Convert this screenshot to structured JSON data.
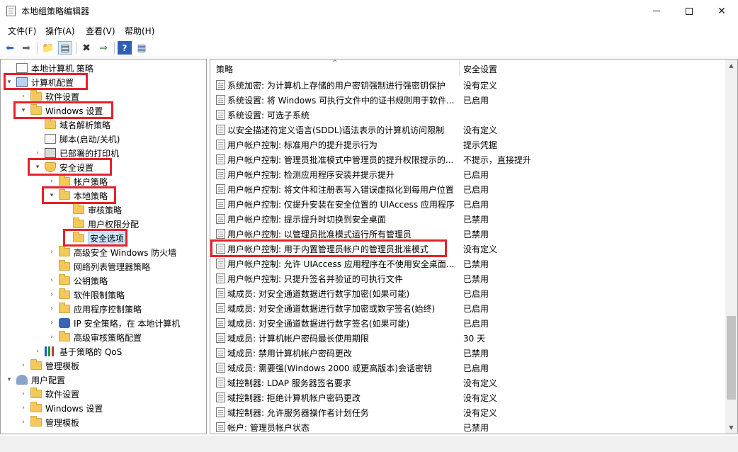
{
  "window": {
    "title": "本地组策略编辑器"
  },
  "menu": [
    "文件(F)",
    "操作(A)",
    "查看(V)",
    "帮助(H)"
  ],
  "toolbar": {
    "icons": [
      "back-arrow-icon",
      "forward-arrow-icon",
      "up-folder-icon",
      "show-hide-tree-icon",
      "delete-icon",
      "export-icon",
      "help-icon",
      "properties-icon"
    ],
    "glyphs": [
      "⬅",
      "➡",
      "📁",
      "▤",
      "✖",
      "⇒",
      "?",
      "▦"
    ]
  },
  "tree": [
    {
      "label": "本地计算机 策略",
      "indent": 0,
      "arrow": "",
      "icon": "doc"
    },
    {
      "label": "计算机配置",
      "indent": 0,
      "arrow": "▾",
      "icon": "computer"
    },
    {
      "label": "软件设置",
      "indent": 1,
      "arrow": "›",
      "icon": "folder"
    },
    {
      "label": "Windows 设置",
      "indent": 1,
      "arrow": "▾",
      "icon": "folder"
    },
    {
      "label": "域名解析策略",
      "indent": 2,
      "arrow": "",
      "icon": "folder"
    },
    {
      "label": "脚本(启动/关机)",
      "indent": 2,
      "arrow": "",
      "icon": "doc"
    },
    {
      "label": "已部署的打印机",
      "indent": 2,
      "arrow": "›",
      "icon": "printer"
    },
    {
      "label": "安全设置",
      "indent": 2,
      "arrow": "▾",
      "icon": "shield"
    },
    {
      "label": "帐户策略",
      "indent": 3,
      "arrow": "›",
      "icon": "folder"
    },
    {
      "label": "本地策略",
      "indent": 3,
      "arrow": "▾",
      "icon": "folder"
    },
    {
      "label": "审核策略",
      "indent": 4,
      "arrow": "",
      "icon": "folder"
    },
    {
      "label": "用户权限分配",
      "indent": 4,
      "arrow": "",
      "icon": "folder"
    },
    {
      "label": "安全选项",
      "indent": 4,
      "arrow": "",
      "icon": "folder",
      "selected": true
    },
    {
      "label": "高级安全 Windows 防火墙",
      "indent": 3,
      "arrow": "›",
      "icon": "folder"
    },
    {
      "label": "网络列表管理器策略",
      "indent": 3,
      "arrow": "",
      "icon": "folder"
    },
    {
      "label": "公钥策略",
      "indent": 3,
      "arrow": "›",
      "icon": "folder"
    },
    {
      "label": "软件限制策略",
      "indent": 3,
      "arrow": "›",
      "icon": "folder"
    },
    {
      "label": "应用程序控制策略",
      "indent": 3,
      "arrow": "›",
      "icon": "folder"
    },
    {
      "label": "IP 安全策略，在 本地计算机",
      "indent": 3,
      "arrow": "›",
      "icon": "lock"
    },
    {
      "label": "高级审核策略配置",
      "indent": 3,
      "arrow": "›",
      "icon": "folder"
    },
    {
      "label": "基于策略的 QoS",
      "indent": 2,
      "arrow": "›",
      "icon": "bars"
    },
    {
      "label": "管理模板",
      "indent": 1,
      "arrow": "›",
      "icon": "folder"
    },
    {
      "label": "用户配置",
      "indent": 0,
      "arrow": "▾",
      "icon": "user"
    },
    {
      "label": "软件设置",
      "indent": 1,
      "arrow": "›",
      "icon": "folder"
    },
    {
      "label": "Windows 设置",
      "indent": 1,
      "arrow": "›",
      "icon": "folder"
    },
    {
      "label": "管理模板",
      "indent": 1,
      "arrow": "›",
      "icon": "folder"
    }
  ],
  "list": {
    "columns": {
      "policy": "策略",
      "setting": "安全设置"
    },
    "rows": [
      {
        "name": "系统加密: 为计算机上存储的用户密钥强制进行强密钥保护",
        "value": "没有定义"
      },
      {
        "name": "系统设置: 将 Windows 可执行文件中的证书规则用于软件...",
        "value": "已启用"
      },
      {
        "name": "系统设置: 可选子系统",
        "value": ""
      },
      {
        "name": "以安全描述符定义语言(SDDL)语法表示的计算机访问限制",
        "value": "没有定义"
      },
      {
        "name": "用户帐户控制: 标准用户的提升提示行为",
        "value": "提示凭据"
      },
      {
        "name": "用户帐户控制: 管理员批准模式中管理员的提升权限提示的...",
        "value": "不提示，直接提升"
      },
      {
        "name": "用户帐户控制: 检测应用程序安装并提示提升",
        "value": "已启用"
      },
      {
        "name": "用户帐户控制: 将文件和注册表写入错误虚拟化到每用户位置",
        "value": "已启用"
      },
      {
        "name": "用户帐户控制: 仅提升安装在安全位置的 UIAccess 应用程序",
        "value": "已启用"
      },
      {
        "name": "用户帐户控制: 提示提升时切换到安全桌面",
        "value": "已禁用"
      },
      {
        "name": "用户帐户控制: 以管理员批准模式运行所有管理员",
        "value": "已禁用"
      },
      {
        "name": "用户帐户控制: 用于内置管理员帐户的管理员批准模式",
        "value": "没有定义"
      },
      {
        "name": "用户帐户控制: 允许 UIAccess 应用程序在不使用安全桌面...",
        "value": "已禁用"
      },
      {
        "name": "用户帐户控制: 只提升签名并验证的可执行文件",
        "value": "已禁用"
      },
      {
        "name": "域成员: 对安全通道数据进行数字加密(如果可能)",
        "value": "已启用"
      },
      {
        "name": "域成员: 对安全通道数据进行数字加密或数字签名(始终)",
        "value": "已启用"
      },
      {
        "name": "域成员: 对安全通道数据进行数字签名(如果可能)",
        "value": "已启用"
      },
      {
        "name": "域成员: 计算机帐户密码最长使用期限",
        "value": "30 天"
      },
      {
        "name": "域成员: 禁用计算机帐户密码更改",
        "value": "已禁用"
      },
      {
        "name": "域成员: 需要强(Windows 2000 或更高版本)会话密钥",
        "value": "已启用"
      },
      {
        "name": "域控制器: LDAP 服务器签名要求",
        "value": "没有定义"
      },
      {
        "name": "域控制器: 拒绝计算机帐户密码更改",
        "value": "没有定义"
      },
      {
        "name": "域控制器: 允许服务器操作者计划任务",
        "value": "没有定义"
      },
      {
        "name": "帐户: 管理员帐户状态",
        "value": "已禁用"
      }
    ]
  },
  "highlight_color": "#e8202a"
}
